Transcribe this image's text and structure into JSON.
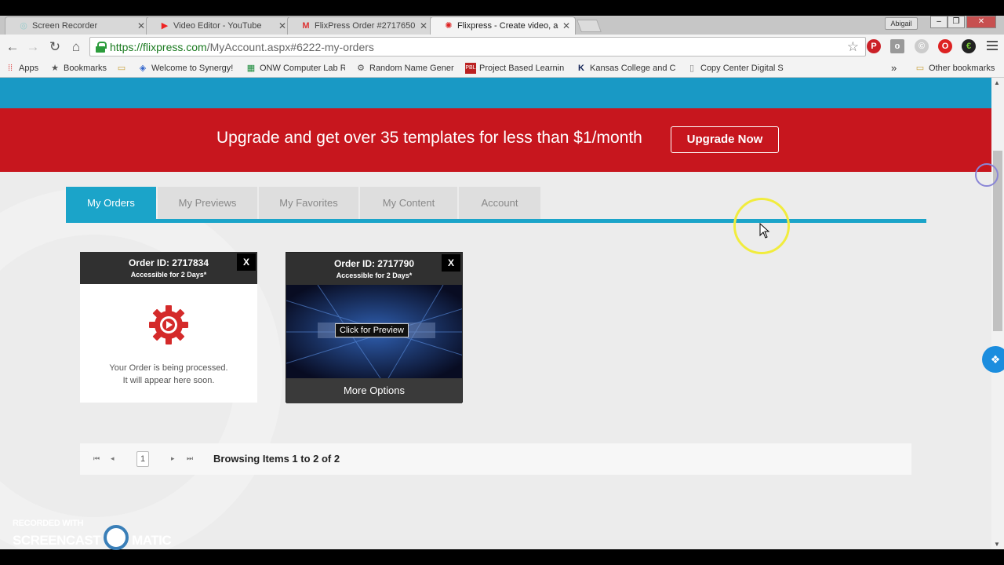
{
  "browser": {
    "tabs": [
      {
        "title": "Screen Recorder",
        "icon": "screen-recorder-icon"
      },
      {
        "title": "Video Editor - YouTube",
        "icon": "youtube-icon"
      },
      {
        "title": "FlixPress Order #2717650",
        "icon": "gmail-icon"
      },
      {
        "title": "Flixpress - Create video, a",
        "icon": "flixpress-icon"
      }
    ],
    "profile_name": "Abigail",
    "url_host": "https://flixpress.com",
    "url_path": "/MyAccount.aspx#6222-my-orders",
    "bookmarks": [
      {
        "label": "Apps",
        "icon": "apps-grid-icon"
      },
      {
        "label": "Bookmarks",
        "icon": "star-icon"
      },
      {
        "label": "",
        "icon": "folder-icon"
      },
      {
        "label": "Welcome to Synergy!",
        "icon": "synergy-icon"
      },
      {
        "label": "ONW Computer Lab R",
        "icon": "sheet-icon"
      },
      {
        "label": "Random Name Gener",
        "icon": "gear-icon"
      },
      {
        "label": "Project Based Learnin",
        "icon": "pbl-icon"
      },
      {
        "label": "Kansas College and C",
        "icon": "k-icon"
      },
      {
        "label": "Copy Center Digital S",
        "icon": "page-icon"
      }
    ],
    "other_bookmarks": "Other bookmarks",
    "more_bookmarks": "»"
  },
  "banner": {
    "text": "Upgrade and get over 35 templates for less than $1/month",
    "button": "Upgrade Now"
  },
  "account_tabs": [
    "My Orders",
    "My Previews",
    "My Favorites",
    "My Content",
    "Account"
  ],
  "orders": [
    {
      "order_id": "Order ID: 2717834",
      "access": "Accessible for 2 Days*",
      "close": "X",
      "status_line1": "Your Order is being processed.",
      "status_line2": "It will appear here soon."
    },
    {
      "order_id": "Order ID: 2717790",
      "access": "Accessible for 2 Days*",
      "close": "X",
      "preview_label": "Click for Preview",
      "more_options": "More Options"
    }
  ],
  "pager": {
    "page": "1",
    "text": "Browsing Items 1 to 2 of 2"
  },
  "watermark": {
    "line1": "RECORDED WITH",
    "brand_left": "SCREENCAST",
    "brand_right": "MATIC"
  },
  "colors": {
    "brand_blue": "#1ba4c9",
    "banner_red": "#c7161e",
    "card_header": "#303030"
  }
}
